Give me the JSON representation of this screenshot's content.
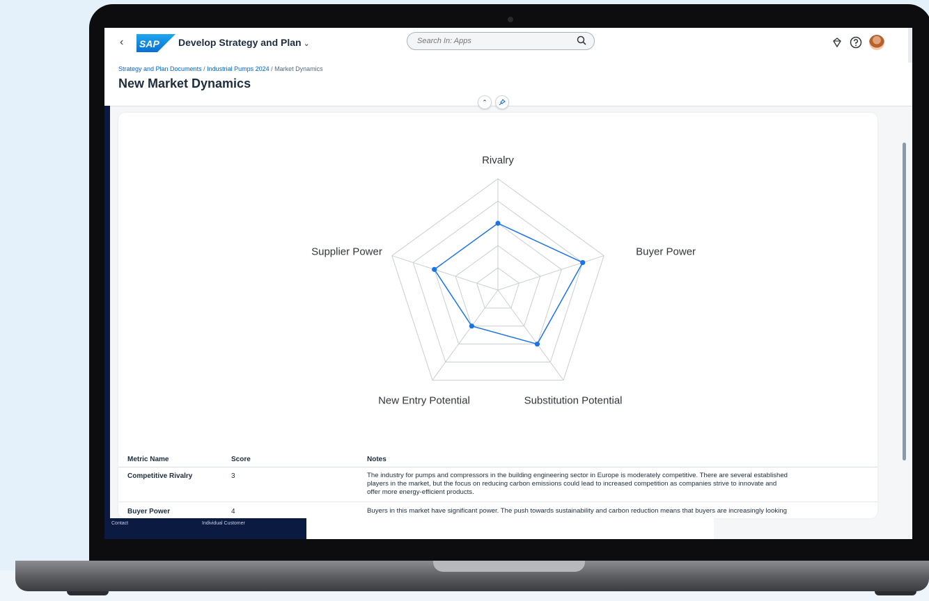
{
  "shell": {
    "back_glyph": "‹",
    "logo_text": "SAP",
    "app_title": "Develop Strategy and Plan",
    "app_title_caret": "⌄",
    "search_placeholder": "Search In: Apps",
    "icons": [
      "back-icon",
      "search-icon",
      "diamond-icon",
      "help-icon",
      "user-avatar"
    ]
  },
  "header": {
    "breadcrumb": [
      {
        "label": "Strategy and Plan Documents",
        "link": true
      },
      {
        "label": "Industrial Pumps 2024",
        "link": true
      },
      {
        "label": "Market Dynamics",
        "link": false
      }
    ],
    "title": "New Market Dynamics",
    "collapse_glyph": "⌃",
    "pin_glyph": "📌"
  },
  "chart_data": {
    "type": "radar",
    "axes": [
      "Rivalry",
      "Buyer Power",
      "Substitution Potential",
      "New Entry Potential",
      "Supplier Power"
    ],
    "values": [
      3,
      4,
      3,
      2,
      3
    ],
    "scale_max": 5,
    "rings": 5,
    "series_color": "#1a73e8",
    "grid_color": "#c9ced4"
  },
  "table": {
    "headers": [
      "Metric Name",
      "Score",
      "Notes"
    ],
    "rows": [
      {
        "name": "Competitive Rivalry",
        "score": "3",
        "notes": [
          "The industry for pumps and compressors in the building engineering sector in Europe is moderately competitive. There are several established",
          "players in the market, but the focus on reducing carbon emissions could lead to increased competition as companies strive to innovate and",
          "offer more energy-efficient products."
        ]
      },
      {
        "name": "Buyer Power",
        "score": "4",
        "notes": [
          "Buyers in this market have significant power. The push towards sustainability and carbon reduction means that buyers are increasingly looking"
        ]
      }
    ]
  },
  "footer_nav": {
    "contact": "Contact",
    "individual_customer": "Individual Customer"
  }
}
